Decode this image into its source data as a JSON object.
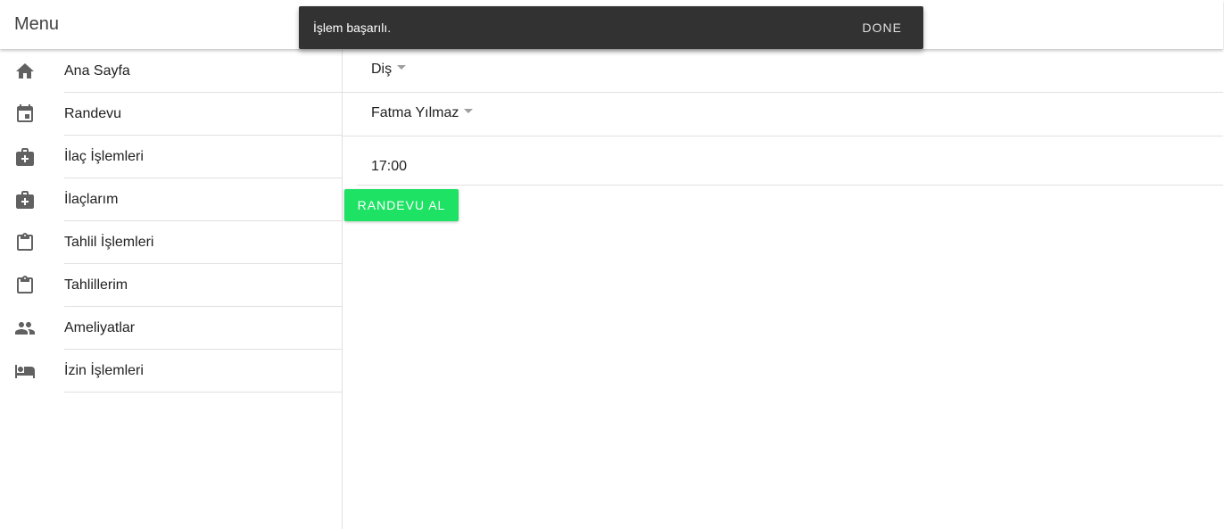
{
  "header": {
    "title": "Menu"
  },
  "sidebar": {
    "items": [
      {
        "label": "Ana Sayfa",
        "icon": "home-icon"
      },
      {
        "label": "Randevu",
        "icon": "calendar-icon"
      },
      {
        "label": "İlaç İşlemleri",
        "icon": "medical-bag-icon"
      },
      {
        "label": "İlaçlarım",
        "icon": "medical-bag-icon"
      },
      {
        "label": "Tahlil İşlemleri",
        "icon": "clipboard-icon"
      },
      {
        "label": "Tahlillerim",
        "icon": "clipboard-icon"
      },
      {
        "label": "Ameliyatlar",
        "icon": "people-icon"
      },
      {
        "label": "İzin İşlemleri",
        "icon": "bed-icon"
      }
    ]
  },
  "form": {
    "department": {
      "value": "Diş"
    },
    "doctor": {
      "value": "Fatma Yılmaz"
    },
    "time": {
      "value": "17:00"
    },
    "submit_label": "RANDEVU AL"
  },
  "snackbar": {
    "message": "İşlem başarılı.",
    "action_label": "DONE"
  },
  "colors": {
    "primary_button": "#1de264",
    "snackbar_bg": "#323232"
  }
}
